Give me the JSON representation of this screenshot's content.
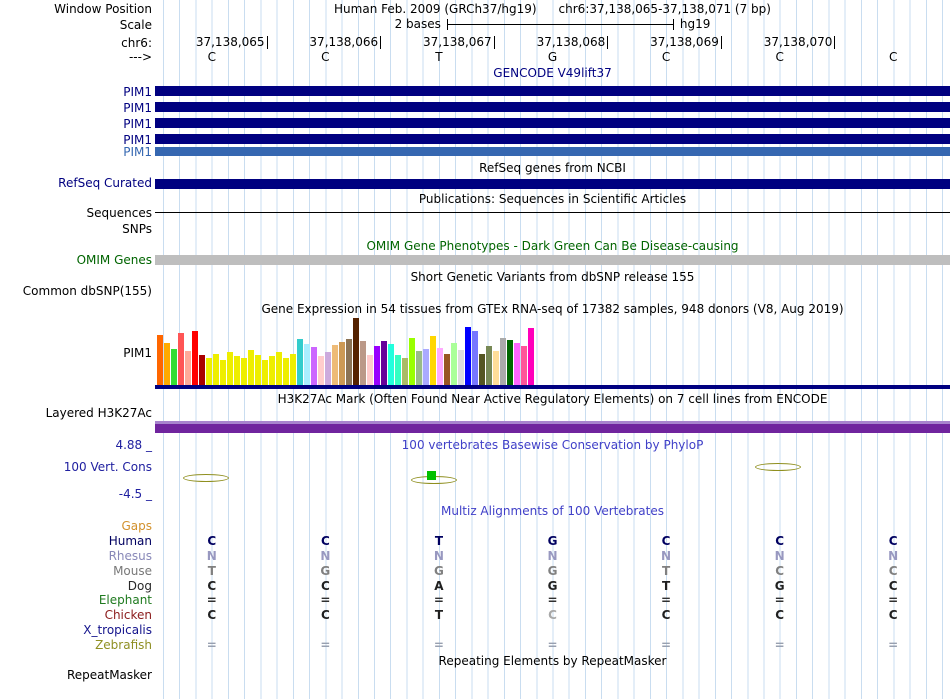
{
  "colors": {
    "gene_navy": "#000080",
    "pim1_light_blue": "#3567B1",
    "omim_bar_gray": "#BEBEBE",
    "h3k27ac_light": "#A883CE",
    "h3k27ac_main": "#70249E",
    "gtex_baseline": "#000080",
    "conservation_mark_olive": "#8F8F1F",
    "conservation_mark_green": "#00C000",
    "guideline_blue": "#c9ddf0"
  },
  "header": {
    "assembly": "Human Feb. 2009 (GRCh37/hg19)",
    "position": "chr6:37,138,065-37,138,071 (7 bp)",
    "scale_value": "2 bases",
    "scale_assembly": "hg19",
    "coords": [
      "37,138,065",
      "37,138,066",
      "37,138,067",
      "37,138,068",
      "37,138,069",
      "37,138,070"
    ],
    "sequence": [
      "C",
      "C",
      "T",
      "G",
      "C",
      "C",
      "C"
    ]
  },
  "side_labels": {
    "window_position": "Window Position",
    "scale": "Scale",
    "chrom": "chr6:",
    "strand": "--->",
    "refseq_curated": "RefSeq Curated",
    "sequences": "Sequences",
    "snps": "SNPs",
    "omim_genes": "OMIM Genes",
    "common_dbsnp": "Common dbSNP(155)",
    "gtex_gene": "PIM1",
    "layered_h3k27ac": "Layered H3K27Ac",
    "cons_max": "4.88 _",
    "cons_name": "100 Vert. Cons",
    "cons_min": "-4.5 _",
    "repeatmasker": "RepeatMasker"
  },
  "tracks": {
    "gencode": {
      "title": "GENCODE V49lift37",
      "items": [
        {
          "label": "PIM1",
          "color": "#000080"
        },
        {
          "label": "PIM1",
          "color": "#000080"
        },
        {
          "label": "PIM1",
          "color": "#000080"
        },
        {
          "label": "PIM1",
          "color": "#000080"
        },
        {
          "label": "PIM1",
          "color": "#3567B1"
        }
      ]
    },
    "refseq": {
      "title": "RefSeq genes from NCBI"
    },
    "publications": {
      "title": "Publications: Sequences in Scientific Articles"
    },
    "omim": {
      "title": "OMIM Gene Phenotypes - Dark Green Can Be Disease-causing"
    },
    "dbsnp": {
      "title": "Short Genetic Variants from dbSNP release 155"
    },
    "gtex": {
      "title": "Gene Expression in 54 tissues from GTEx RNA-seq of 17382 samples, 948 donors (V8, Aug 2019)"
    },
    "encode": {
      "title": "H3K27Ac Mark (Often Found Near Active Regulatory Elements) on 7 cell lines from ENCODE"
    },
    "conservation": {
      "title": "100 vertebrates Basewise Conservation by PhyloP"
    },
    "multiz": {
      "title": "Multiz Alignments of 100 Vertebrates",
      "rows": [
        {
          "name": "Gaps",
          "label_color": "#D2912C",
          "letter_color": "#D2912C",
          "letters": [
            "",
            "",
            "",
            "",
            "",
            "",
            ""
          ]
        },
        {
          "name": "Human",
          "label_color": "#000060",
          "letter_color": "#000060",
          "letters": [
            "C",
            "C",
            "T",
            "G",
            "C",
            "C",
            "C"
          ]
        },
        {
          "name": "Rhesus",
          "label_color": "#8888B8",
          "letter_color": "#9898C0",
          "letters": [
            "N",
            "N",
            "N",
            "N",
            "N",
            "N",
            "N"
          ]
        },
        {
          "name": "Mouse",
          "label_color": "#787878",
          "letter_color": "#808080",
          "letters": [
            "T",
            "G",
            "G",
            "G",
            "T",
            "C",
            "C"
          ]
        },
        {
          "name": "Dog",
          "label_color": "#282828",
          "letter_color": "#202020",
          "letters": [
            "C",
            "C",
            "A",
            "G",
            "T",
            "G",
            "C"
          ]
        },
        {
          "name": "Elephant",
          "label_color": "#1F7A1F",
          "letter_color": "#303030",
          "letters": [
            "=",
            "=",
            "=",
            "=",
            "=",
            "=",
            "="
          ]
        },
        {
          "name": "Chicken",
          "label_color": "#8B1C1C",
          "letter_color": "#202020",
          "letters": [
            "C",
            "C",
            "T",
            "C",
            "C",
            "C",
            "C"
          ],
          "muted": [
            3
          ]
        },
        {
          "name": "X_tropicalis",
          "label_color": "#14148C",
          "letter_color": "#303030",
          "letters": [
            "",
            "",
            "",
            "",
            "",
            "",
            ""
          ]
        },
        {
          "name": "Zebrafish",
          "label_color": "#8F8F23",
          "letter_color": "#98A0B0",
          "letters": [
            "=",
            "=",
            "=",
            "=",
            "=",
            "=",
            "="
          ]
        }
      ]
    },
    "repeatmasker": {
      "title": "Repeating Elements by RepeatMasker"
    }
  },
  "chart_data": {
    "type": "bar",
    "title": "Gene Expression in 54 tissues from GTEx RNA-seq of 17382 samples, 948 donors (V8, Aug 2019)",
    "gene": "PIM1",
    "value_unit": "relative expression bar height (px)",
    "bars": [
      {
        "color": "#FF6600",
        "value": 50
      },
      {
        "color": "#FFAA00",
        "value": 42
      },
      {
        "color": "#33DD33",
        "value": 36
      },
      {
        "color": "#FF5555",
        "value": 52
      },
      {
        "color": "#FFAA99",
        "value": 34
      },
      {
        "color": "#FF0000",
        "value": 54
      },
      {
        "color": "#AA0000",
        "value": 30
      },
      {
        "color": "#EEEE00",
        "value": 27
      },
      {
        "color": "#EEEE00",
        "value": 31
      },
      {
        "color": "#EEEE00",
        "value": 25
      },
      {
        "color": "#EEEE00",
        "value": 33
      },
      {
        "color": "#EEEE00",
        "value": 29
      },
      {
        "color": "#EEEE00",
        "value": 27
      },
      {
        "color": "#EEEE00",
        "value": 35
      },
      {
        "color": "#EEEE00",
        "value": 30
      },
      {
        "color": "#EEEE00",
        "value": 25
      },
      {
        "color": "#EEEE00",
        "value": 29
      },
      {
        "color": "#EEEE00",
        "value": 33
      },
      {
        "color": "#EEEE00",
        "value": 27
      },
      {
        "color": "#EEEE00",
        "value": 31
      },
      {
        "color": "#33CCCC",
        "value": 46
      },
      {
        "color": "#AAEEFF",
        "value": 41
      },
      {
        "color": "#CC66FF",
        "value": 38
      },
      {
        "color": "#FFCCCC",
        "value": 29
      },
      {
        "color": "#CCAADD",
        "value": 33
      },
      {
        "color": "#EEBB77",
        "value": 40
      },
      {
        "color": "#CC9955",
        "value": 43
      },
      {
        "color": "#8B7355",
        "value": 46
      },
      {
        "color": "#552200",
        "value": 67
      },
      {
        "color": "#BB9988",
        "value": 44
      },
      {
        "color": "#FFCCCC",
        "value": 30
      },
      {
        "color": "#9900FF",
        "value": 39
      },
      {
        "color": "#660099",
        "value": 44
      },
      {
        "color": "#22FFDD",
        "value": 41
      },
      {
        "color": "#33FFC2",
        "value": 30
      },
      {
        "color": "#AABB66",
        "value": 27
      },
      {
        "color": "#99FF00",
        "value": 47
      },
      {
        "color": "#99BB88",
        "value": 34
      },
      {
        "color": "#AAAAFF",
        "value": 36
      },
      {
        "color": "#FFD700",
        "value": 49
      },
      {
        "color": "#FFAAFF",
        "value": 37
      },
      {
        "color": "#995522",
        "value": 31
      },
      {
        "color": "#AAFF99",
        "value": 42
      },
      {
        "color": "#DDDDDD",
        "value": 35
      },
      {
        "color": "#0000FF",
        "value": 58
      },
      {
        "color": "#7777FF",
        "value": 54
      },
      {
        "color": "#555522",
        "value": 31
      },
      {
        "color": "#778855",
        "value": 39
      },
      {
        "color": "#FFDD99",
        "value": 34
      },
      {
        "color": "#AAAAAA",
        "value": 47
      },
      {
        "color": "#006600",
        "value": 45
      },
      {
        "color": "#FF66FF",
        "value": 42
      },
      {
        "color": "#FF5599",
        "value": 39
      },
      {
        "color": "#FF00BB",
        "value": 57
      }
    ]
  }
}
